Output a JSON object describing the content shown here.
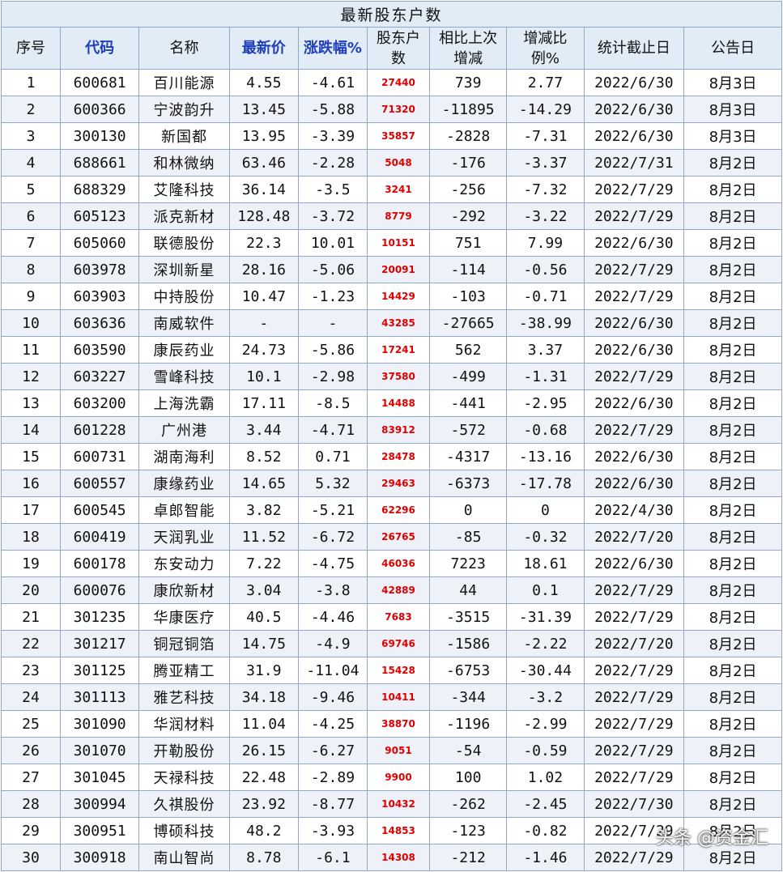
{
  "title": "最新股东户数",
  "headers": [
    "序号",
    "代码",
    "名称",
    "最新价",
    "涨跌幅%",
    "股东户数",
    "相比上次增减",
    "增减比例%",
    "统计截止日",
    "公告日"
  ],
  "rows": [
    [
      "1",
      "600681",
      "百川能源",
      "4.55",
      "-4.61",
      "27440",
      "739",
      "2.77",
      "2022/6/30",
      "8月3日"
    ],
    [
      "2",
      "600366",
      "宁波韵升",
      "13.45",
      "-5.88",
      "71320",
      "-11895",
      "-14.29",
      "2022/6/30",
      "8月3日"
    ],
    [
      "3",
      "300130",
      "新国都",
      "13.95",
      "-3.39",
      "35857",
      "-2828",
      "-7.31",
      "2022/6/30",
      "8月3日"
    ],
    [
      "4",
      "688661",
      "和林微纳",
      "63.46",
      "-2.28",
      "5048",
      "-176",
      "-3.37",
      "2022/7/31",
      "8月2日"
    ],
    [
      "5",
      "688329",
      "艾隆科技",
      "36.14",
      "-3.5",
      "3241",
      "-256",
      "-7.32",
      "2022/7/29",
      "8月2日"
    ],
    [
      "6",
      "605123",
      "派克新材",
      "128.48",
      "-3.72",
      "8779",
      "-292",
      "-3.22",
      "2022/7/29",
      "8月2日"
    ],
    [
      "7",
      "605060",
      "联德股份",
      "22.3",
      "10.01",
      "10151",
      "751",
      "7.99",
      "2022/6/30",
      "8月2日"
    ],
    [
      "8",
      "603978",
      "深圳新星",
      "28.16",
      "-5.06",
      "20091",
      "-114",
      "-0.56",
      "2022/7/29",
      "8月2日"
    ],
    [
      "9",
      "603903",
      "中持股份",
      "10.47",
      "-1.23",
      "14429",
      "-103",
      "-0.71",
      "2022/7/29",
      "8月2日"
    ],
    [
      "10",
      "603636",
      "南威软件",
      "-",
      "-",
      "43285",
      "-27665",
      "-38.99",
      "2022/6/30",
      "8月2日"
    ],
    [
      "11",
      "603590",
      "康辰药业",
      "24.73",
      "-5.86",
      "17241",
      "562",
      "3.37",
      "2022/6/30",
      "8月2日"
    ],
    [
      "12",
      "603227",
      "雪峰科技",
      "10.1",
      "-2.98",
      "37580",
      "-499",
      "-1.31",
      "2022/7/29",
      "8月2日"
    ],
    [
      "13",
      "603200",
      "上海洗霸",
      "17.11",
      "-8.5",
      "14488",
      "-441",
      "-2.95",
      "2022/6/30",
      "8月2日"
    ],
    [
      "14",
      "601228",
      "广州港",
      "3.44",
      "-4.71",
      "83912",
      "-572",
      "-0.68",
      "2022/7/29",
      "8月2日"
    ],
    [
      "15",
      "600731",
      "湖南海利",
      "8.52",
      "0.71",
      "28478",
      "-4317",
      "-13.16",
      "2022/6/30",
      "8月2日"
    ],
    [
      "16",
      "600557",
      "康缘药业",
      "14.65",
      "5.32",
      "29463",
      "-6373",
      "-17.78",
      "2022/6/30",
      "8月2日"
    ],
    [
      "17",
      "600545",
      "卓郎智能",
      "3.82",
      "-5.21",
      "62296",
      "0",
      "0",
      "2022/4/30",
      "8月2日"
    ],
    [
      "18",
      "600419",
      "天润乳业",
      "11.52",
      "-6.72",
      "26765",
      "-85",
      "-0.32",
      "2022/7/20",
      "8月2日"
    ],
    [
      "19",
      "600178",
      "东安动力",
      "7.22",
      "-4.75",
      "46036",
      "7223",
      "18.61",
      "2022/6/30",
      "8月2日"
    ],
    [
      "20",
      "600076",
      "康欣新材",
      "3.04",
      "-3.8",
      "42889",
      "44",
      "0.1",
      "2022/7/29",
      "8月2日"
    ],
    [
      "21",
      "301235",
      "华康医疗",
      "40.5",
      "-4.46",
      "7683",
      "-3515",
      "-31.39",
      "2022/7/29",
      "8月2日"
    ],
    [
      "22",
      "301217",
      "铜冠铜箔",
      "14.75",
      "-4.9",
      "69746",
      "-1586",
      "-2.22",
      "2022/7/20",
      "8月2日"
    ],
    [
      "23",
      "301125",
      "腾亚精工",
      "31.9",
      "-11.04",
      "15428",
      "-6753",
      "-30.44",
      "2022/7/29",
      "8月2日"
    ],
    [
      "24",
      "301113",
      "雅艺科技",
      "34.18",
      "-9.46",
      "10411",
      "-344",
      "-3.2",
      "2022/7/29",
      "8月2日"
    ],
    [
      "25",
      "301090",
      "华润材料",
      "11.04",
      "-4.25",
      "38870",
      "-1196",
      "-2.99",
      "2022/7/29",
      "8月2日"
    ],
    [
      "26",
      "301070",
      "开勒股份",
      "26.15",
      "-6.27",
      "9051",
      "-54",
      "-0.59",
      "2022/7/29",
      "8月2日"
    ],
    [
      "27",
      "301045",
      "天禄科技",
      "22.48",
      "-2.89",
      "9900",
      "100",
      "1.02",
      "2022/7/29",
      "8月2日"
    ],
    [
      "28",
      "300994",
      "久祺股份",
      "23.92",
      "-8.77",
      "10432",
      "-262",
      "-2.45",
      "2022/7/30",
      "8月2日"
    ],
    [
      "29",
      "300951",
      "博硕科技",
      "48.2",
      "-3.93",
      "14853",
      "-123",
      "-0.82",
      "2022/7/29",
      "8月2日"
    ],
    [
      "30",
      "300918",
      "南山智尚",
      "8.78",
      "-6.1",
      "14308",
      "-212",
      "-1.46",
      "2022/7/29",
      "8月2日"
    ]
  ],
  "watermark": "头条 @资金汇",
  "colors": {
    "header_bg": "#e1ecf7",
    "border": "#8fa8c8",
    "accent_blue": "#1f3fb8",
    "holders_red": "#e00000",
    "alt_row": "#eef2f8"
  }
}
